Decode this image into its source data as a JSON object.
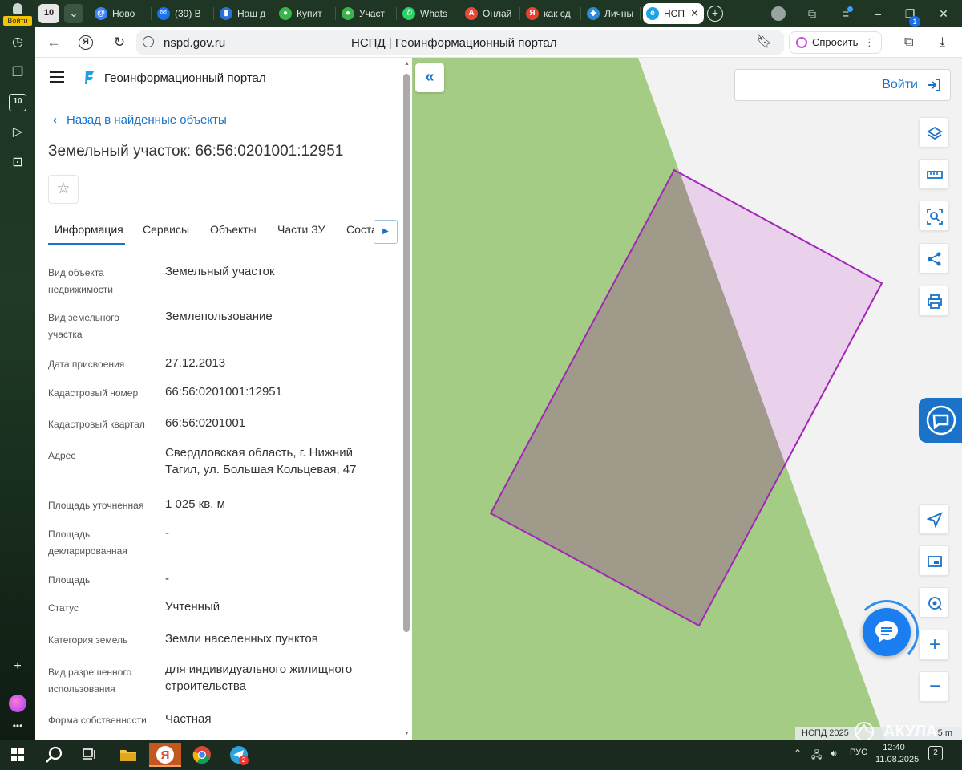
{
  "sidebar": {
    "login_label": "Войти",
    "number_badge": "10"
  },
  "tabs": [
    {
      "label": "Ново",
      "icon": "at-icon",
      "color": "#3b82f6"
    },
    {
      "label": "(39) В",
      "icon": "mail-icon",
      "color": "#1a73e8"
    },
    {
      "label": "Наш д",
      "icon": "docs-icon",
      "color": "#2a6fdb"
    },
    {
      "label": "Купит",
      "icon": "dots-icon",
      "color": "#39b54a"
    },
    {
      "label": "Участ",
      "icon": "dots-icon",
      "color": "#39b54a"
    },
    {
      "label": "Whats",
      "icon": "whatsapp-icon",
      "color": "#25d366"
    },
    {
      "label": "Онлай",
      "icon": "pdf-icon",
      "color": "#e04b3a"
    },
    {
      "label": "как сд",
      "icon": "yandex-icon",
      "color": "#e8412c"
    },
    {
      "label": "Личны",
      "icon": "shield-icon",
      "color": "#2c8bd6"
    },
    {
      "label": "НСП",
      "icon": "nspd-icon",
      "color": "#1aa4e8"
    }
  ],
  "browser": {
    "url": "nspd.gov.ru",
    "page_title": "НСПД | Геоинформационный портал",
    "ask_label": "Спросить",
    "download_count": "1"
  },
  "panel": {
    "portal_name": "Геоинформационный портал",
    "back_link": "Назад в найденные объекты",
    "title": "Земельный участок: 66:56:0201001:12951",
    "tabs": [
      "Информация",
      "Сервисы",
      "Объекты",
      "Части ЗУ",
      "Соста"
    ],
    "rows": [
      {
        "key": "Вид объекта недвижимости",
        "value": "Земельный участок"
      },
      {
        "key": "Вид земельного участка",
        "value": "Землепользование"
      },
      {
        "key": "Дата присвоения",
        "value": "27.12.2013"
      },
      {
        "key": "Кадастровый номер",
        "value": "66:56:0201001:12951"
      },
      {
        "key": "Кадастровый квартал",
        "value": "66:56:0201001"
      },
      {
        "key": "Адрес",
        "value": "Свердловская область, г. Нижний Тагил, ул. Большая Кольцевая, 47"
      },
      {
        "key": "Площадь уточненная",
        "value": "1 025 кв. м"
      },
      {
        "key": "Площадь декларированная",
        "value": "-"
      },
      {
        "key": "Площадь",
        "value": "-"
      },
      {
        "key": "Статус",
        "value": "Учтенный"
      },
      {
        "key": "Категория земель",
        "value": "Земли населенных пунктов"
      },
      {
        "key": "Вид разрешенного использования",
        "value": "для индивидуального жилищного строительства"
      },
      {
        "key": "Форма собственности",
        "value": "Частная"
      }
    ]
  },
  "map": {
    "login_label": "Войти",
    "zoom_in": "+",
    "zoom_out": "−",
    "copyright": "НСПД 2025",
    "scale": "5 m",
    "watermark": "АКУЛА",
    "colors": {
      "green_zone": "#a5cc85",
      "parcel_stroke": "#a126b8",
      "parcel_fill": "#e6c8e8",
      "accent": "#1a73c9"
    }
  },
  "taskbar": {
    "lang": "РУС",
    "time": "12:40",
    "date": "11.08.2025",
    "telegram_badge": "2",
    "notif_count": "2"
  }
}
